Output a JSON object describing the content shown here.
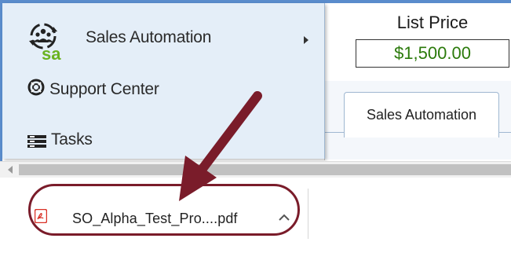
{
  "menu": {
    "items": [
      {
        "label": "Sales Automation",
        "icon": "sales-automation-icon",
        "has_submenu": true
      },
      {
        "label": "Support Center",
        "icon": "lifebuoy-icon"
      },
      {
        "label": "Tasks",
        "icon": "tasks-icon"
      }
    ],
    "logo_text": "sa"
  },
  "price": {
    "title": "List Price",
    "value": "$1,500.00",
    "value_color": "#2b7a0b"
  },
  "tabs": [
    {
      "label": "Sales Automation"
    }
  ],
  "download": {
    "filename": "SO_Alpha_Test_Pro....pdf",
    "file_icon": "pdf-icon"
  },
  "annotation": {
    "arrow_color": "#7a1c2a",
    "highlight_color": "#7a1c2a"
  }
}
